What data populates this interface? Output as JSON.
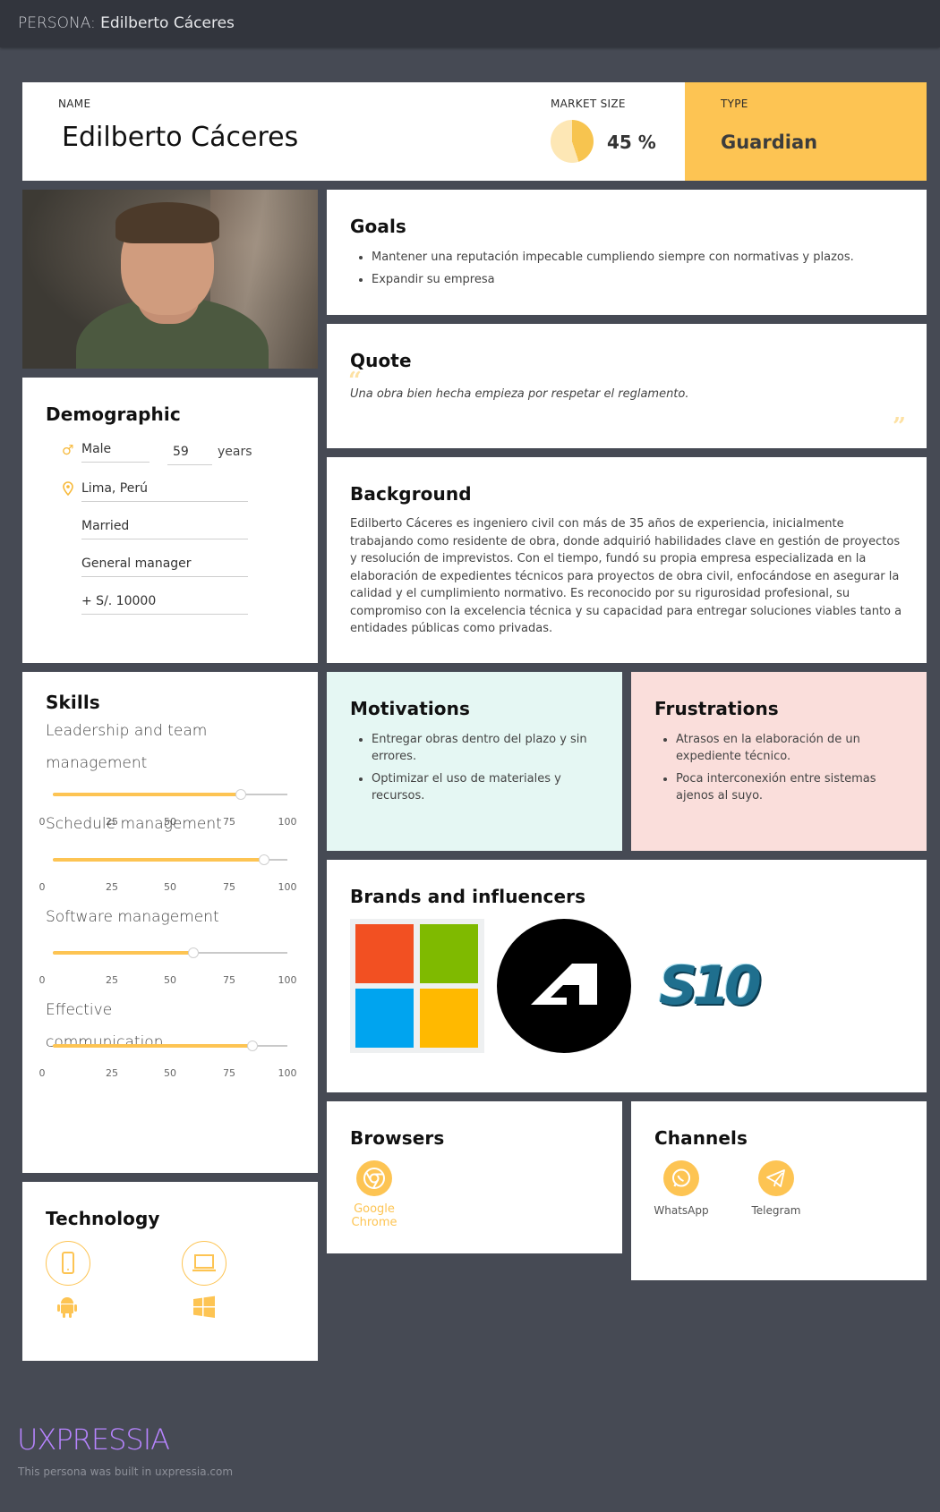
{
  "topbar": {
    "prefix": "PERSONA:",
    "name": "Edilberto Cáceres"
  },
  "header": {
    "name_label": "NAME",
    "name": "Edilberto Cáceres",
    "market_label": "MARKET SIZE",
    "market_value": "45 %",
    "market_fraction": 0.45,
    "type_label": "TYPE",
    "type_value": "Guardian"
  },
  "goals": {
    "title": "Goals",
    "items": [
      "Mantener una reputación impecable cumpliendo siempre con normativas y plazos.",
      "Expandir su empresa"
    ]
  },
  "quote": {
    "title": "Quote",
    "text": "Una obra bien hecha empieza por respetar el reglamento."
  },
  "background": {
    "title": "Background",
    "text": "Edilberto Cáceres es ingeniero civil con más de 35 años de experiencia, inicialmente trabajando como residente de obra, donde adquirió habilidades clave en gestión de proyectos y resolución de imprevistos. Con el tiempo, fundó su propia empresa especializada en la elaboración de expedientes técnicos para proyectos de obra civil, enfocándose en asegurar la calidad y el cumplimiento normativo. Es reconocido por su rigurosidad profesional, su compromiso con la excelencia técnica y su capacidad para entregar soluciones viables tanto a entidades públicas como privadas."
  },
  "demographic": {
    "title": "Demographic",
    "gender": "Male",
    "age": "59",
    "age_unit": "years",
    "location": "Lima, Perú",
    "status": "Married",
    "job": "General manager",
    "income": "+ S/. 10000"
  },
  "skills": {
    "title": "Skills",
    "ticks": [
      "0",
      "25",
      "50",
      "75",
      "100"
    ],
    "items": [
      {
        "name": "Leadership and team management",
        "value": 80
      },
      {
        "name": "Schedule management",
        "value": 90
      },
      {
        "name": "Software management",
        "value": 60
      },
      {
        "name": "Effective communication",
        "value": 85
      }
    ]
  },
  "motivations": {
    "title": "Motivations",
    "items": [
      "Entregar obras dentro del plazo y sin errores.",
      "Optimizar el uso de materiales y recursos."
    ]
  },
  "frustrations": {
    "title": "Frustrations",
    "items": [
      "Atrasos en la elaboración de un expediente técnico.",
      "Poca interconexión entre sistemas ajenos al suyo."
    ]
  },
  "brands": {
    "title": "Brands and influencers",
    "logos": [
      "microsoft-logo",
      "autodesk-logo",
      "s10-logo"
    ],
    "s10_text": "S10"
  },
  "browsers": {
    "title": "Browsers",
    "items": [
      {
        "name": "Google Chrome",
        "icon": "chrome-icon"
      }
    ]
  },
  "channels": {
    "title": "Channels",
    "items": [
      {
        "name": "WhatsApp",
        "icon": "whatsapp-icon"
      },
      {
        "name": "Telegram",
        "icon": "telegram-icon"
      }
    ]
  },
  "technology": {
    "title": "Technology",
    "icons": [
      "mobile-phone-icon",
      "laptop-icon",
      "android-icon",
      "windows-icon"
    ]
  },
  "footer": {
    "brand": "UXPRESSIA",
    "note": "This persona was built in uxpressia.com"
  },
  "colors": {
    "accent": "#fdc453",
    "background": "#464a54",
    "topbar": "#32353d",
    "motivations": "#e5f7f3",
    "frustrations": "#fadedb",
    "brand": "#b784ff"
  }
}
